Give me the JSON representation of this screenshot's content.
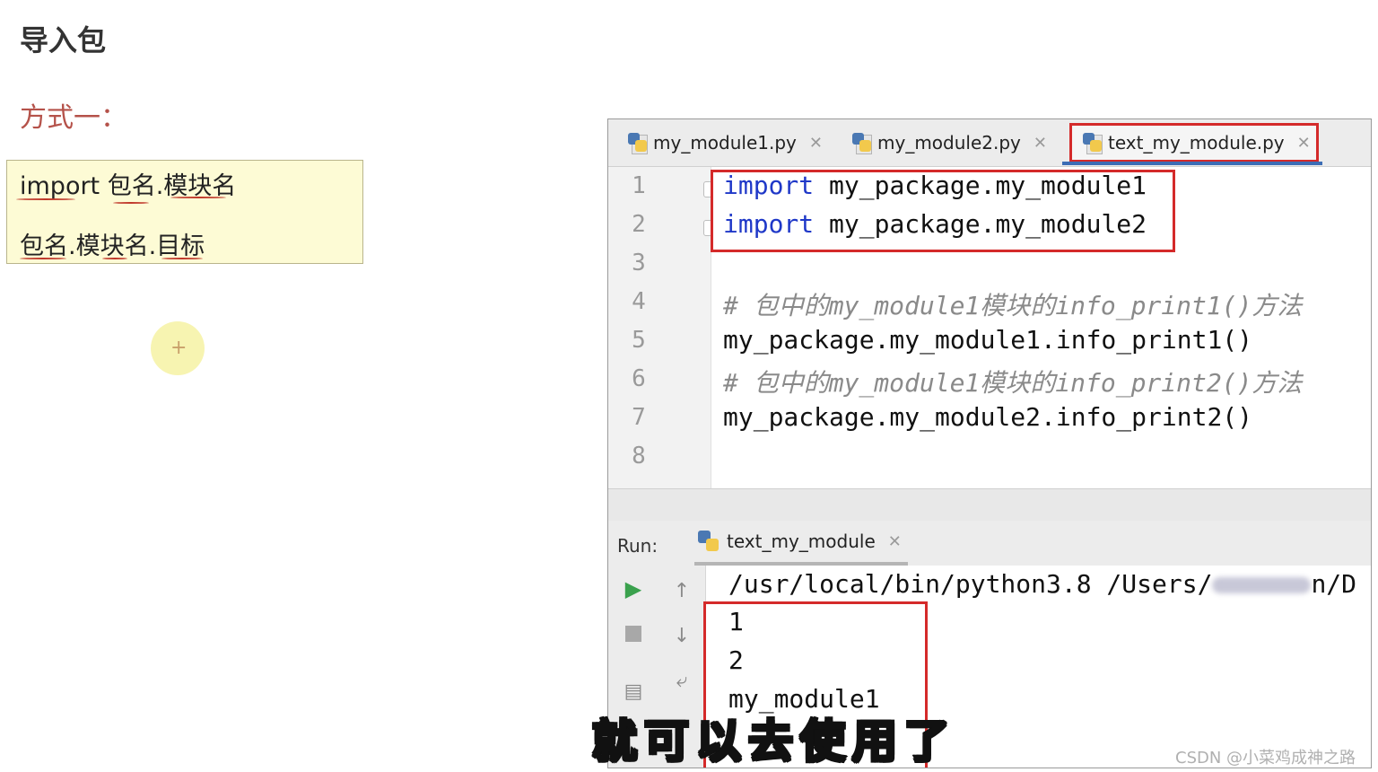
{
  "slide": {
    "title": "导入包",
    "method_label": "方式一：",
    "syntax_line1": "import 包名.模块名",
    "syntax_line2": "包名.模块名.目标"
  },
  "ide": {
    "tabs": [
      {
        "label": "my_module1.py",
        "active": false
      },
      {
        "label": "my_module2.py",
        "active": false
      },
      {
        "label": "text_my_module.py",
        "active": true
      }
    ],
    "line_numbers": [
      "1",
      "2",
      "3",
      "4",
      "5",
      "6",
      "7",
      "8"
    ],
    "code": {
      "l1_kw": "import",
      "l1_rest": " my_package.my_module1",
      "l2_kw": "import",
      "l2_rest": " my_package.my_module2",
      "l4": "# 包中的my_module1模块的info_print1()方法",
      "l5": "my_package.my_module1.info_print1()",
      "l6": "# 包中的my_module1模块的info_print2()方法",
      "l7": "my_package.my_module2.info_print2()"
    },
    "run": {
      "label": "Run:",
      "tab_label": "text_my_module"
    },
    "console": {
      "cmd_start": "/usr/local/bin/python3.8 /Users/",
      "cmd_end": "n/D",
      "out1": "1",
      "out2": "2",
      "out3": "my_module1"
    }
  },
  "subtitle": "就可以去使用了",
  "watermark": "CSDN @小菜鸡成神之路",
  "colors": {
    "highlight_box": "#d42a2a",
    "keyword": "#1f38c8",
    "comment": "#8a8a8a",
    "note_bg": "#fdfbd5"
  }
}
